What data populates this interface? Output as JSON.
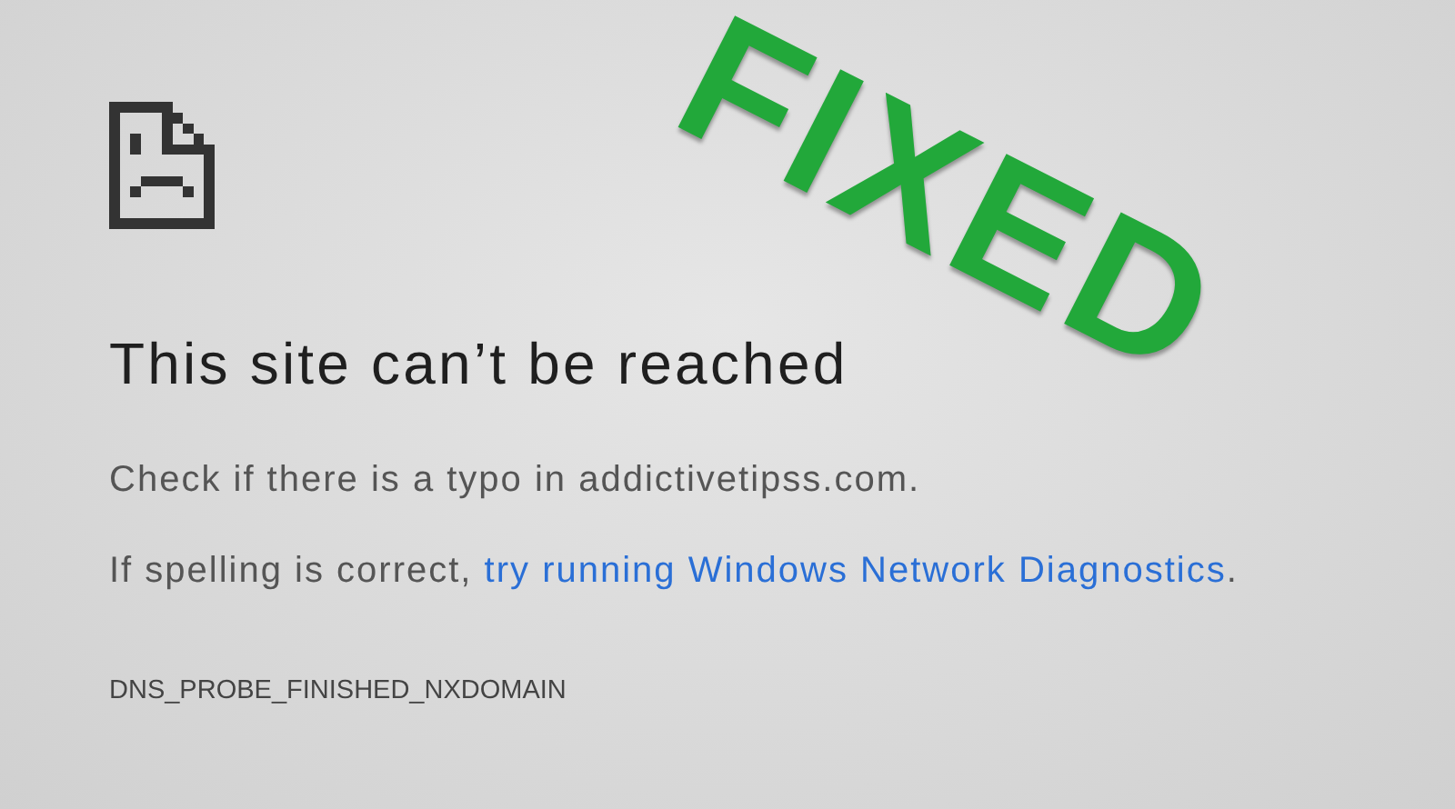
{
  "error_page": {
    "heading": "This site can’t be reached",
    "messages": [
      {
        "kind": "plain",
        "text": "Check if there is a typo in addictivetipss.com."
      },
      {
        "kind": "link",
        "text": "If spelling is correct, ",
        "link": "try running Windows Network Diagnostics",
        "after": "."
      }
    ],
    "error_code": "DNS_PROBE_FINISHED_NXDOMAIN"
  },
  "stamp": {
    "text": "FIXED",
    "color": "#22a83a"
  }
}
